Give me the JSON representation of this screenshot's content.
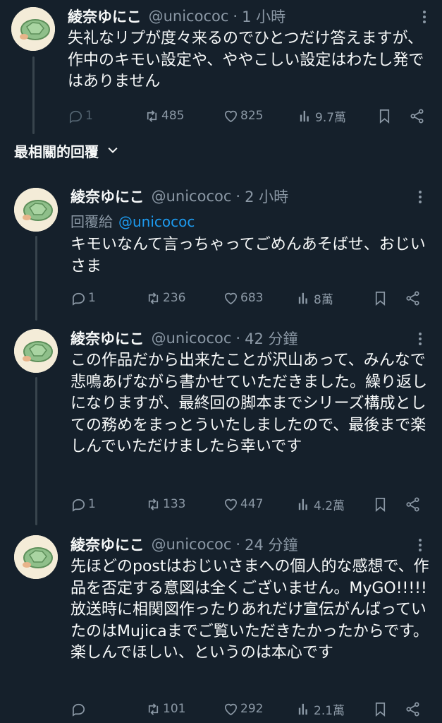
{
  "colors": {
    "background": "#15202b",
    "text": "#f7f9f9",
    "muted": "#8b98a5",
    "link": "#1d9bf0"
  },
  "sort_label": "最相關的回覆",
  "tweets": [
    {
      "name": "綾奈ゆにこ",
      "handle": "@unicococ",
      "time": "1 小時",
      "reply_prefix": "",
      "reply_to": "",
      "text": "失礼なリプが度々来るのでひとつだけ答えますが、作中のキモい設定や、ややこしい設定はわたし発ではありません",
      "stats": {
        "replies": "1",
        "reposts": "485",
        "likes": "825",
        "views": "9.7萬"
      }
    },
    {
      "name": "綾奈ゆにこ",
      "handle": "@unicococ",
      "time": "2 小時",
      "reply_prefix": "回覆給",
      "reply_to": "@unicococ",
      "text": "キモいなんて言っちゃってごめんあそばせ、おじいさま",
      "stats": {
        "replies": "1",
        "reposts": "236",
        "likes": "683",
        "views": "8萬"
      }
    },
    {
      "name": "綾奈ゆにこ",
      "handle": "@unicococ",
      "time": "42 分鐘",
      "reply_prefix": "",
      "reply_to": "",
      "text": "この作品だから出来たことが沢山あって、みんなで悲鳴あげながら書かせていただきました。繰り返しになりますが、最終回の脚本までシリーズ構成としての務めをまっとういたしましたので、最後まで楽しんでいただけましたら幸いです",
      "stats": {
        "replies": "1",
        "reposts": "133",
        "likes": "447",
        "views": "4.2萬"
      }
    },
    {
      "name": "綾奈ゆにこ",
      "handle": "@unicococ",
      "time": "24 分鐘",
      "reply_prefix": "",
      "reply_to": "",
      "text": "先ほどのpostはおじいさまへの個人的な感想で、作品を否定する意図は全くございません。MyGO!!!!! 放送時に相関図作ったりあれだけ宣伝がんばっていたのはMujicaまでご覧いただきたかったからです。楽しんでほしい、というのは本心です",
      "stats": {
        "replies": "",
        "reposts": "101",
        "likes": "292",
        "views": "2.1萬"
      }
    }
  ]
}
